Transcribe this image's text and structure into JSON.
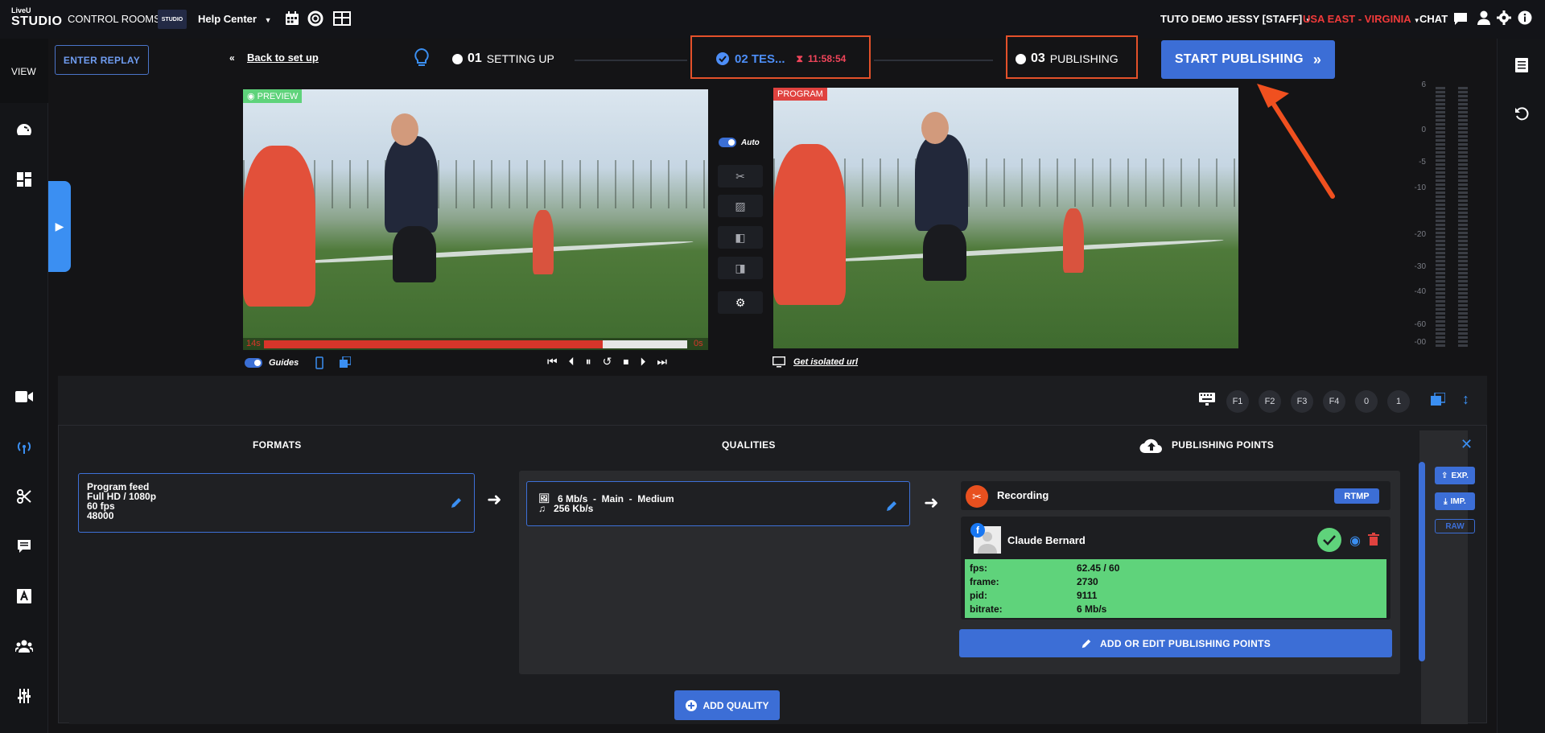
{
  "topbar": {
    "logo_top": "LiveU",
    "logo_main": "STUDIO",
    "control_rooms": "CONTROL ROOMS",
    "room_badge": "STUDIO",
    "help_center": "Help Center",
    "user": "TUTO DEMO JESSY [STAFF]",
    "region": "USA EAST - VIRGINIA",
    "chat": "CHAT"
  },
  "leftnav": {
    "view_label": "VIEW"
  },
  "header": {
    "enter_replay": "ENTER REPLAY",
    "back": "Back to set up",
    "step1_num": "01",
    "step1_label": "SETTING UP",
    "step2_label": "02 TES...",
    "step2_timer": "11:58:54",
    "step3_num": "03",
    "step3_label": "PUBLISHING",
    "start": "START PUBLISHING"
  },
  "preview": {
    "tag": "PREVIEW",
    "time_left": "14s",
    "time_right": "0s",
    "progress": 0.8,
    "guides_label": "Guides"
  },
  "program": {
    "tag": "PROGRAM",
    "isolated": "Get isolated url"
  },
  "controls": {
    "auto_label": "Auto"
  },
  "meter": {
    "ticks": [
      "6",
      "0",
      "-5",
      "-10",
      "-20",
      "-30",
      "-40",
      "-60",
      "-00"
    ]
  },
  "fkeys": [
    "F1",
    "F2",
    "F3",
    "F4",
    "0",
    "1"
  ],
  "tabs": {
    "formats": "FORMATS",
    "qualities": "QUALITIES",
    "publishing": "PUBLISHING POINTS"
  },
  "format_card": {
    "line1": "Program feed",
    "line2": "Full HD / 1080p",
    "line3": "60 fps",
    "line4": "48000"
  },
  "quality_card": {
    "video": "6 Mb/s  -  Main  -  Medium",
    "audio": "256 Kb/s"
  },
  "recording": {
    "label": "Recording",
    "badge": "RTMP"
  },
  "publisher": {
    "name": "Claude Bernard",
    "stats": [
      {
        "k": "fps:",
        "v": "62.45 / 60"
      },
      {
        "k": "frame:",
        "v": "2730"
      },
      {
        "k": "pid:",
        "v": "9111"
      },
      {
        "k": "bitrate:",
        "v": "6 Mb/s"
      }
    ]
  },
  "buttons": {
    "add_edit": "ADD OR EDIT PUBLISHING POINTS",
    "add_quality": "ADD QUALITY",
    "exp": "EXP.",
    "imp": "IMP.",
    "raw": "RAW"
  },
  "colors": {
    "accent": "#3c6ed6",
    "alert": "#e4512a",
    "ok": "#5fd37b",
    "timer": "#f0455a",
    "region": "#f03a3a"
  }
}
